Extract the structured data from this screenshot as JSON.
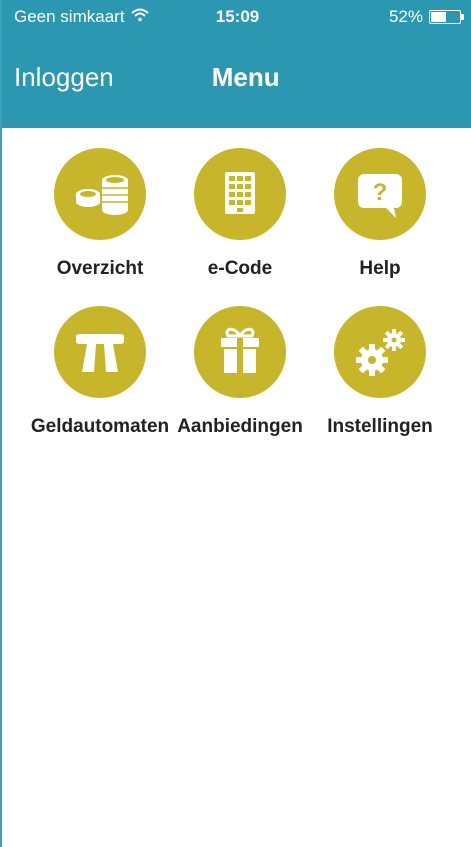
{
  "status_bar": {
    "carrier": "Geen simkaart",
    "time": "15:09",
    "battery_percent": "52%",
    "battery_level": 0.52,
    "wifi_icon": "wifi-icon"
  },
  "nav": {
    "left_button": "Inloggen",
    "title": "Menu"
  },
  "menu": {
    "items": [
      {
        "label": "Overzicht",
        "icon": "coins-icon"
      },
      {
        "label": "e-Code",
        "icon": "keypad-icon"
      },
      {
        "label": "Help",
        "icon": "help-bubble-icon"
      },
      {
        "label": "Geldautomaten",
        "icon": "atm-road-icon"
      },
      {
        "label": "Aanbiedingen",
        "icon": "gift-icon"
      },
      {
        "label": "Instellingen",
        "icon": "gears-icon"
      }
    ]
  },
  "colors": {
    "header": "#2c97b1",
    "icon_circle": "#c8b62a",
    "text": "#222222"
  }
}
